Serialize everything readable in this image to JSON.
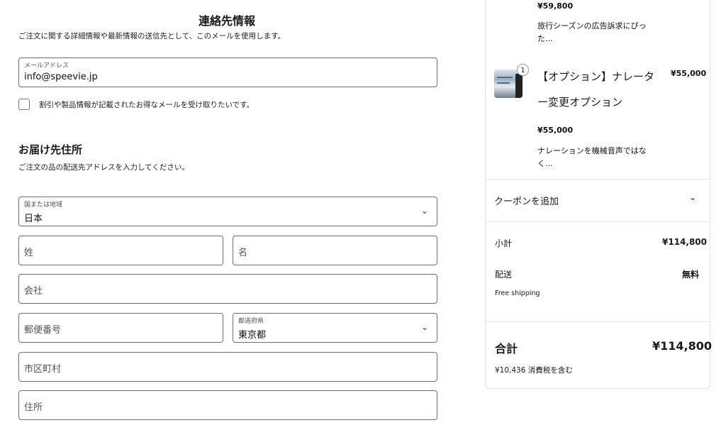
{
  "contact": {
    "title": "連絡先情報",
    "subtitle": "ご注文に関する詳細情報や最新情報の送信先として、このメールを使用します。",
    "email_label": "メールアドレス",
    "email_value": "info@speevie.jp",
    "newsletter_label": "割引や製品情報が記載されたお得なメールを受け取りたいです。"
  },
  "shipping": {
    "title": "お届け先住所",
    "subtitle": "ご注文の品の配送先アドレスを入力してください。",
    "country_label": "国または地域",
    "country_value": "日本",
    "last_name_placeholder": "姓",
    "first_name_placeholder": "名",
    "company_placeholder": "会社",
    "postal_placeholder": "郵便番号",
    "prefecture_label": "都道府県",
    "prefecture_value": "東京都",
    "city_placeholder": "市区町村",
    "address_placeholder": "住所"
  },
  "summary": {
    "item1": {
      "price": "¥59,800",
      "desc_line1": "旅行シーズンの広告訴求にぴっ",
      "desc_line2": "た..."
    },
    "item2": {
      "qty": "1",
      "title_line1": "【オプション】ナレータ",
      "title_line2": "ー変更オプション",
      "price_right": "¥55,000",
      "price": "¥55,000",
      "desc_line1": "ナレーションを機械音声ではな",
      "desc_line2": "く..."
    },
    "coupon_label": "クーポンを追加",
    "subtotal_label": "小計",
    "subtotal_value": "¥114,800",
    "shipping_label": "配送",
    "shipping_value": "無料",
    "shipping_note": "Free shipping",
    "total_label": "合計",
    "total_value": "¥114,800",
    "tax_note": "¥10,436 消費税を含む"
  },
  "icons": {
    "chevron": "chevron-down-icon",
    "checkbox": "checkbox-icon"
  }
}
